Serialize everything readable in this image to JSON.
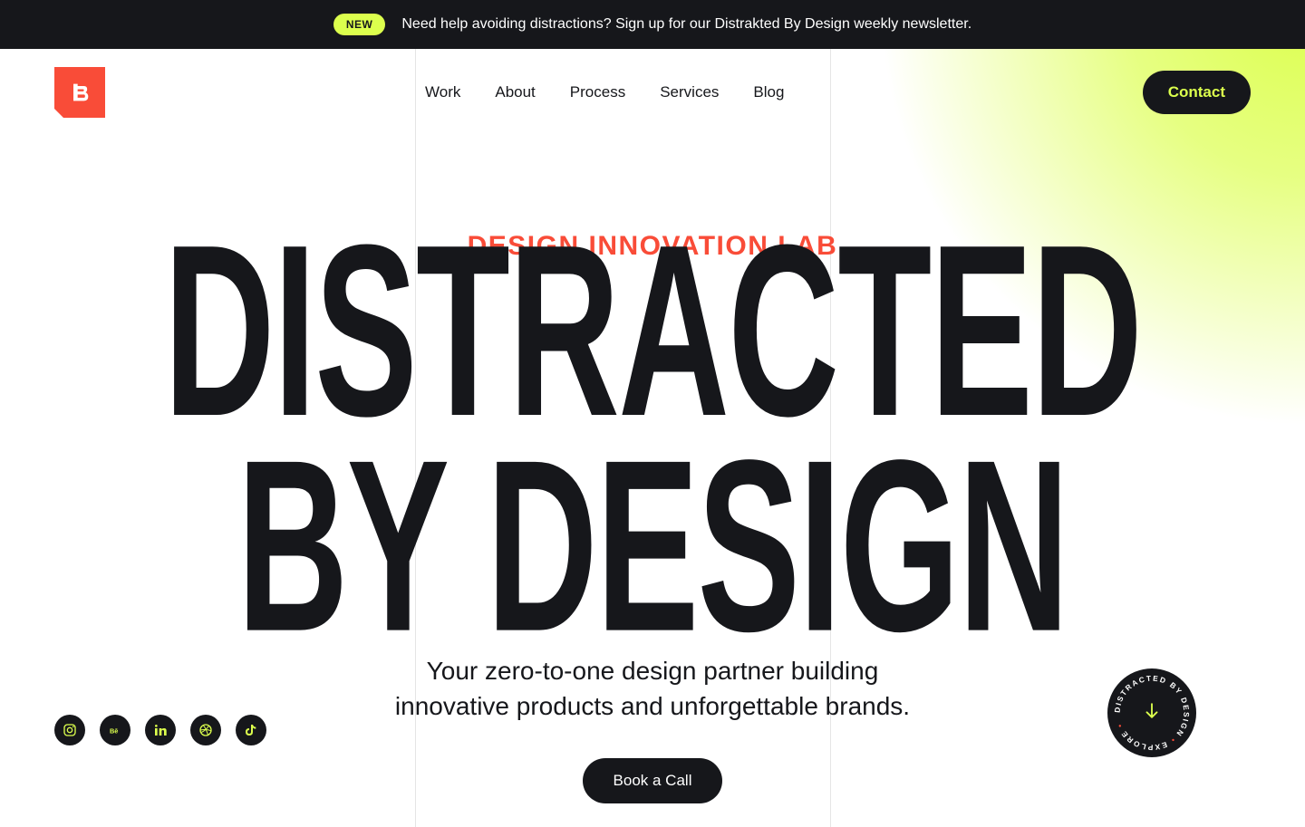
{
  "announcement": {
    "badge": "NEW",
    "text": "Need help avoiding distractions? Sign up for our Distrakted By Design weekly newsletter."
  },
  "nav": {
    "links": [
      "Work",
      "About",
      "Process",
      "Services",
      "Blog"
    ],
    "contact": "Contact"
  },
  "hero": {
    "subtitle": "DESIGN INNOVATION LAB",
    "title": "DISTRACTED BY DESIGN",
    "description_line1": "Your zero-to-one design partner building",
    "description_line2": "innovative products and unforgettable brands.",
    "cta": "Book a Call"
  },
  "badge": {
    "text": "DISTRACTED BY DESIGN • EXPLORE •"
  },
  "social": [
    "instagram",
    "behance",
    "linkedin",
    "dribbble",
    "tiktok"
  ],
  "colors": {
    "accent": "#DCFF4D",
    "orange": "#F94C38",
    "dark": "#16171b"
  }
}
